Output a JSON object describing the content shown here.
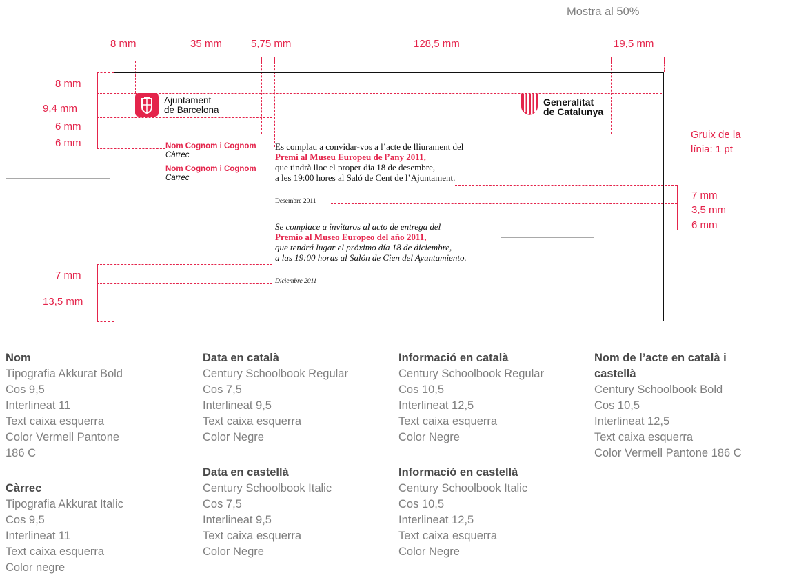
{
  "sample_label": "Mostra al 50%",
  "top_dims": [
    "8 mm",
    "35 mm",
    "5,75 mm",
    "128,5 mm",
    "19,5 mm"
  ],
  "left_dims": [
    "8 mm",
    "9,4 mm",
    "6 mm",
    "6 mm",
    "7 mm",
    "13,5 mm"
  ],
  "right_dims": [
    "7 mm",
    "3,5 mm",
    "6 mm"
  ],
  "line_note": [
    "Gruix de la",
    "línia: 1 pt"
  ],
  "logos": {
    "barcelona": [
      "Ajuntament",
      "de Barcelona"
    ],
    "generalitat": [
      "Generalitat",
      "de Catalunya"
    ]
  },
  "names": [
    {
      "name": "Nom Cognom i Cognom",
      "role": "Càrrec"
    },
    {
      "name": "Nom Cognom i Cognom",
      "role": "Càrrec"
    }
  ],
  "catalan": {
    "line1": "Es complau a convidar-vos a l’acte de lliurament del",
    "event": "Premi al Museu Europeu de l’any 2011,",
    "line3": "que tindrà lloc el proper dia 18 de desembre,",
    "line4": "a les 19:00 hores al Saló de Cent de l’Ajuntament.",
    "date": "Desembre 2011"
  },
  "spanish": {
    "line1": "Se complace a invitaros al acto de entrega del",
    "event": "Premio al Museo Europeo del año 2011,",
    "line3": "que tendrá lugar el próximo día 18 de diciembre,",
    "line4": "a las 19:00 horas al Salón de Cien del Ayuntamiento.",
    "date": "Diciembre 2011"
  },
  "specs": {
    "nom": {
      "title": "Nom",
      "lines": [
        "Tipografia Akkurat Bold",
        "Cos 9,5",
        "Interlineat 11",
        "Text caixa esquerra",
        "Color Vermell Pantone",
        "186 C"
      ]
    },
    "carrec": {
      "title": "Càrrec",
      "lines": [
        "Tipografia Akkurat Italic",
        "Cos 9,5",
        "Interlineat 11",
        "Text caixa esquerra",
        "Color negre"
      ]
    },
    "data_cat": {
      "title": "Data en català",
      "lines": [
        "Century Schoolbook Regular",
        "Cos 7,5",
        "Interlineat 9,5",
        "Text caixa esquerra",
        "Color Negre"
      ]
    },
    "data_cas": {
      "title": "Data en castellà",
      "lines": [
        "Century Schoolbook Italic",
        "Cos 7,5",
        "Interlineat 9,5",
        "Text caixa esquerra",
        "Color Negre"
      ]
    },
    "info_cat": {
      "title": "Informació en català",
      "lines": [
        "Century Schoolbook Regular",
        "Cos 10,5",
        "Interlineat 12,5",
        "Text caixa esquerra",
        "Color Negre"
      ]
    },
    "info_cas": {
      "title": "Informació en castellà",
      "lines": [
        "Century Schoolbook Italic",
        "Cos 10,5",
        "Interlineat 12,5",
        "Text caixa esquerra",
        "Color Negre"
      ]
    },
    "acte": {
      "title": [
        "Nom de l’acte en català i",
        "castellà"
      ],
      "lines": [
        "Century Schoolbook Bold",
        "Cos 10,5",
        "Interlineat 12,5",
        "Text caixa esquerra",
        "Color Vermell Pantone 186 C"
      ]
    }
  },
  "colors": {
    "accent": "#e4244b",
    "text": "#111111",
    "annotation": "#7f7f7f"
  }
}
